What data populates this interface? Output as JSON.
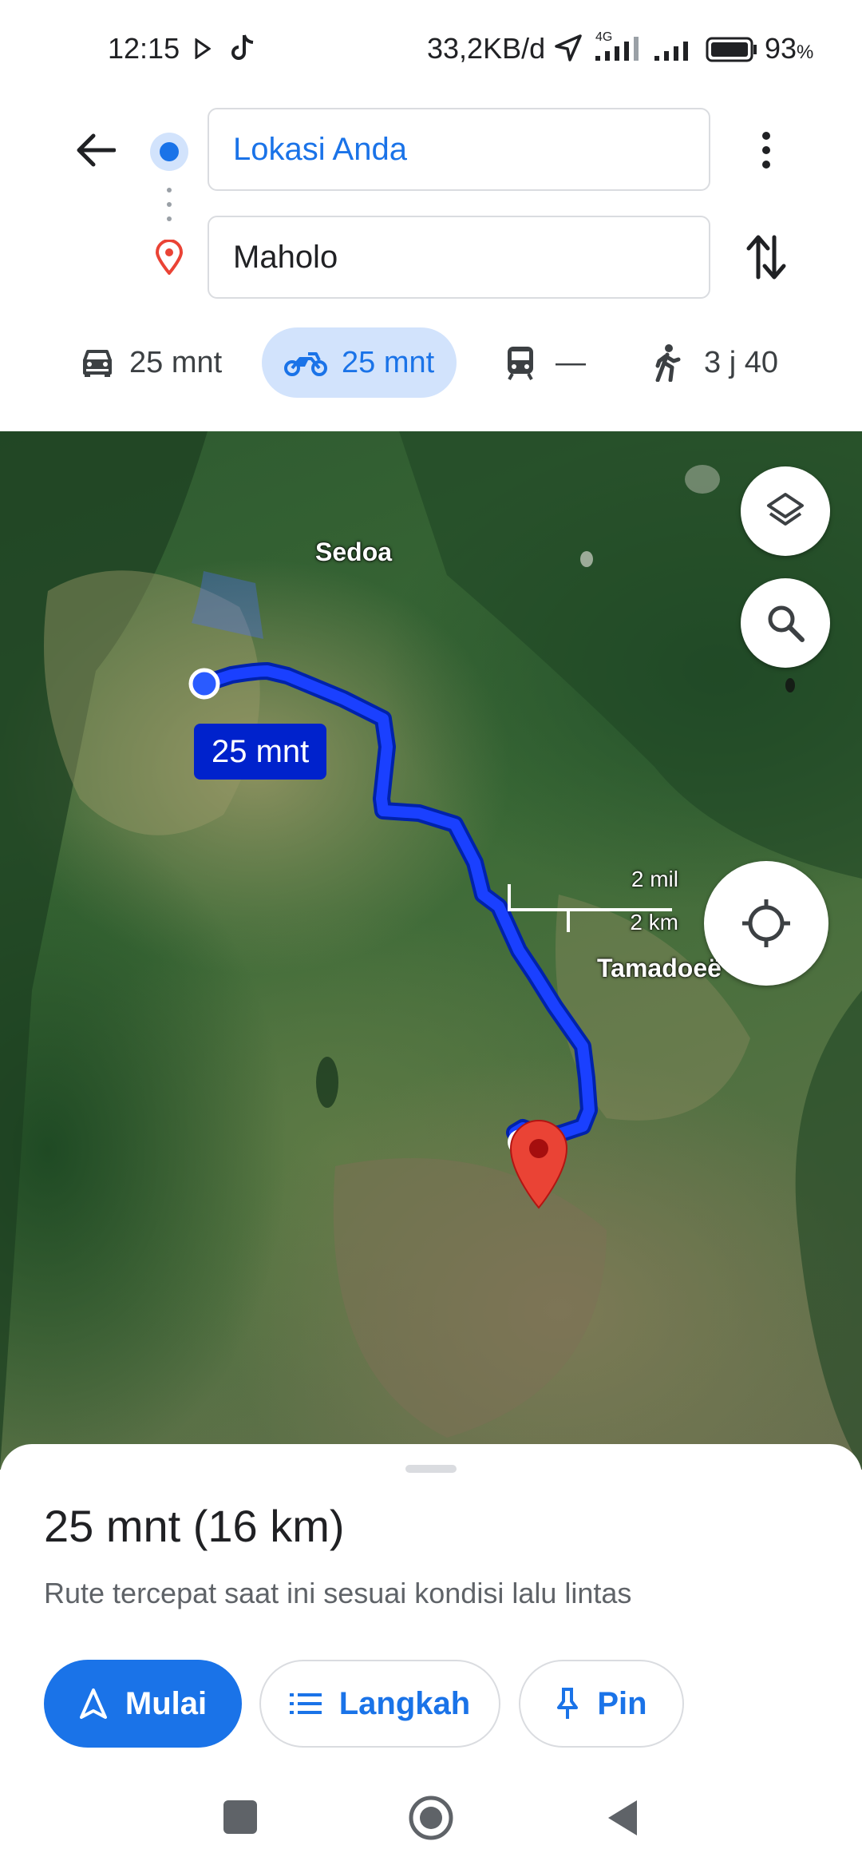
{
  "status_bar": {
    "time": "12:15",
    "network_speed": "33,2KB/d",
    "network_type": "4G",
    "battery": "93",
    "battery_unit": "%"
  },
  "directions": {
    "origin": "Lokasi Anda",
    "destination": "Maholo"
  },
  "modes": [
    {
      "icon": "car-icon",
      "label": "25 mnt",
      "active": false
    },
    {
      "icon": "motorcycle-icon",
      "label": "25 mnt",
      "active": true
    },
    {
      "icon": "transit-icon",
      "label": "—",
      "active": false
    },
    {
      "icon": "walk-icon",
      "label": "3 j 40",
      "active": false
    }
  ],
  "map": {
    "place_labels": [
      "Sedoa",
      "Tamadoeë"
    ],
    "route_label": "25 mnt",
    "scale_miles": "2 mil",
    "scale_km": "2 km",
    "route_color": "#1a40ff"
  },
  "summary": {
    "title": "25 mnt (16 km)",
    "subtitle": "Rute tercepat saat ini sesuai kondisi lalu lintas"
  },
  "actions": {
    "start": "Mulai",
    "steps": "Langkah",
    "pin": "Pin"
  },
  "colors": {
    "accent": "#1a73e8",
    "marker": "#ea4335"
  }
}
